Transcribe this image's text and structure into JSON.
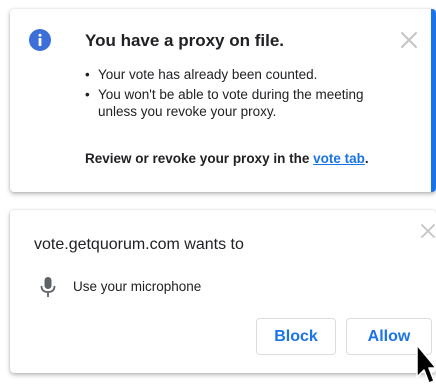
{
  "colors": {
    "accent": "#1a73e8",
    "info_icon": "#3c6fd8",
    "close_icon": "#c4c4c4",
    "link": "#1a73e8",
    "text": "#202124",
    "mic_icon": "#5f6368"
  },
  "proxy_notice": {
    "icon": "info-icon",
    "title": "You have a proxy on file.",
    "bullets": [
      "Your vote has already been counted.",
      "You won't be able to vote during the meeting unless you revoke your proxy."
    ],
    "action_prefix": "Review or revoke your proxy in the ",
    "action_link": "vote tab",
    "action_suffix": ".",
    "close_icon": "close-icon"
  },
  "permission_prompt": {
    "origin_text": "vote.getquorum.com wants to",
    "request_icon": "microphone-icon",
    "request_text": "Use your microphone",
    "block_label": "Block",
    "allow_label": "Allow",
    "close_icon": "close-icon"
  }
}
